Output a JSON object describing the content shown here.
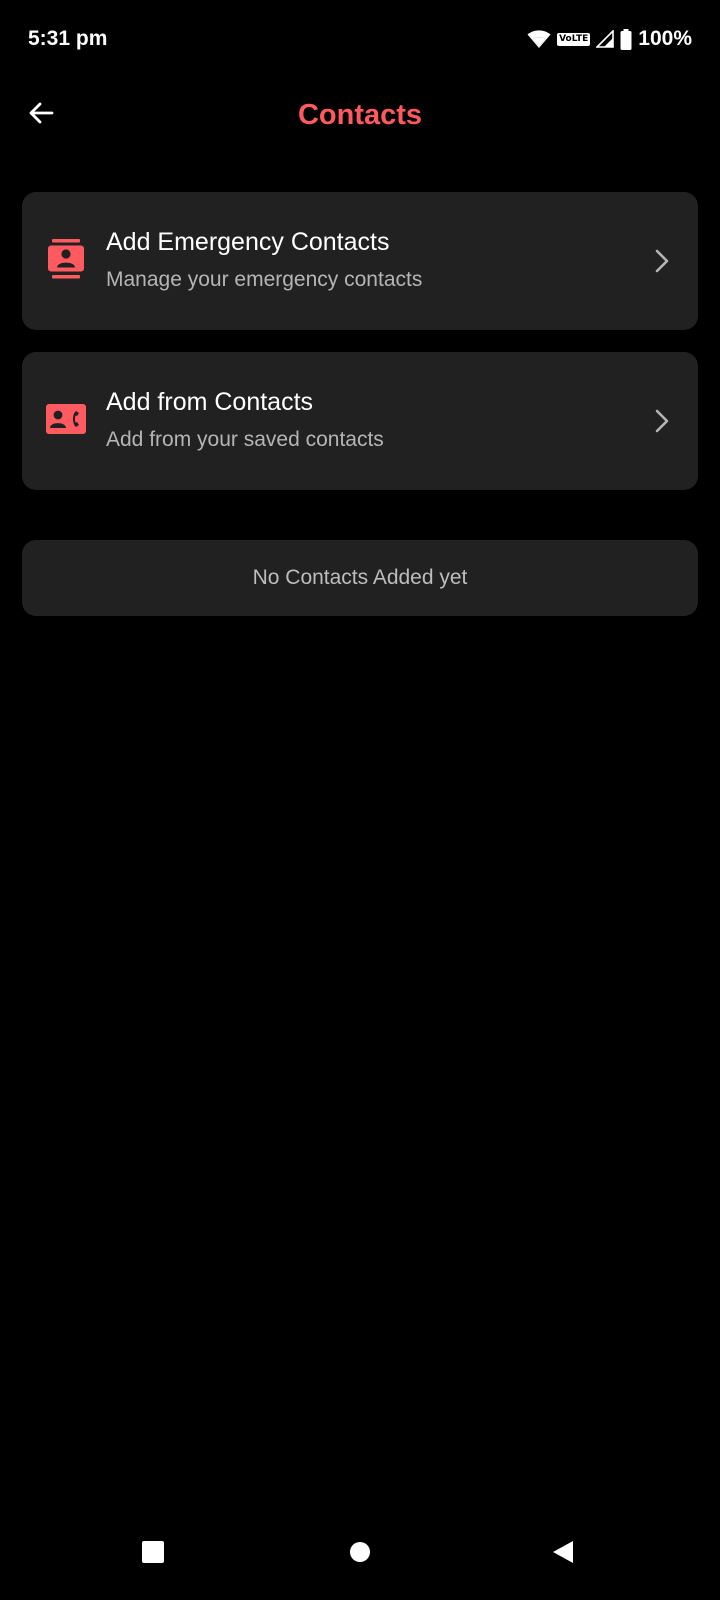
{
  "status_bar": {
    "time": "5:31 pm",
    "volte": "VoLTE",
    "battery": "100%",
    "icons": [
      "wifi-icon",
      "volte-icon",
      "signal-icon",
      "battery-icon"
    ]
  },
  "app_bar": {
    "title": "Contacts",
    "back_icon": "arrow-left-icon"
  },
  "options": [
    {
      "title": "Add Emergency Contacts",
      "subtitle": "Manage your emergency contacts",
      "icon": "contact-card-icon"
    },
    {
      "title": "Add from Contacts",
      "subtitle": "Add from your saved contacts",
      "icon": "contact-phone-icon"
    }
  ],
  "empty_state": {
    "text": "No Contacts Added yet"
  },
  "nav_bar": {
    "icons": [
      "recents-square-icon",
      "home-circle-icon",
      "back-triangle-icon"
    ]
  },
  "colors": {
    "accent": "#ff5a5f",
    "background": "#000000",
    "card": "#212121",
    "subtitle": "#b5b5b5"
  }
}
